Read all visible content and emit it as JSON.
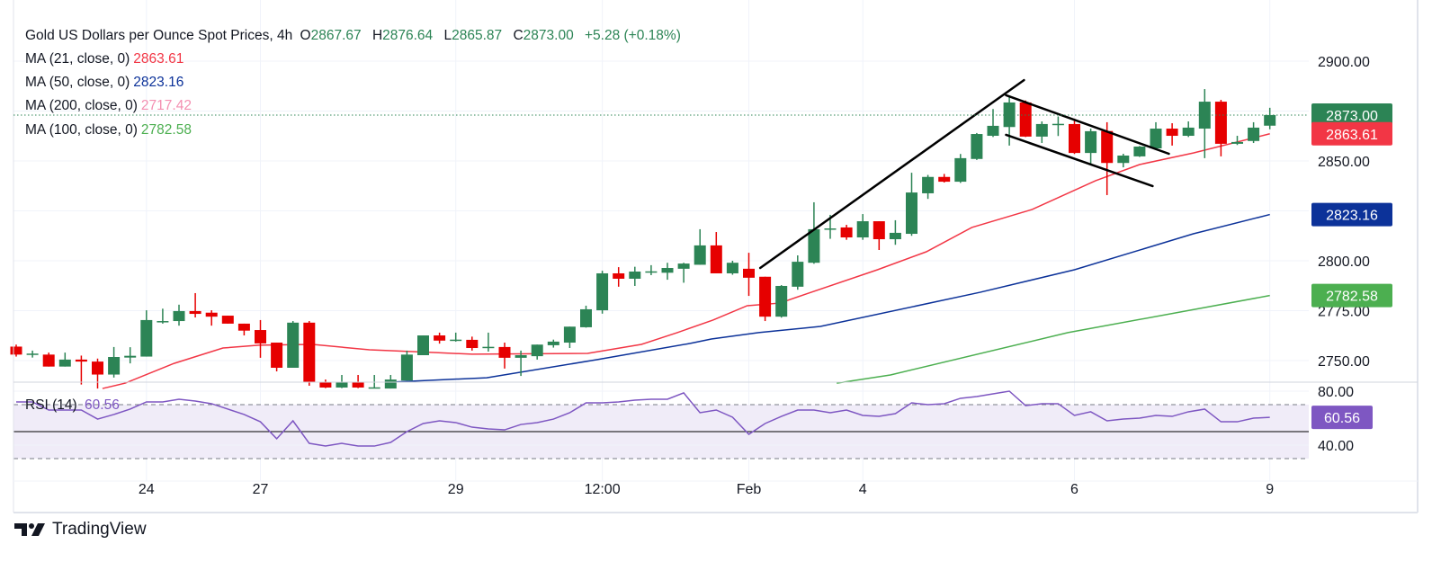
{
  "header": {
    "symbol": "Gold US Dollars per Ounce Spot Prices, 4h",
    "o_label": "O",
    "o_value": "2867.67",
    "h_label": "H",
    "h_value": "2876.64",
    "l_label": "L",
    "l_value": "2865.87",
    "c_label": "C",
    "c_value": "2873.00",
    "change": "+5.28 (+0.18%)"
  },
  "indicators": [
    {
      "label": "MA (21, close, 0)",
      "value": "2863.61",
      "color": "#f23645"
    },
    {
      "label": "MA (50, close, 0)",
      "value": "2823.16",
      "color": "#0c3299"
    },
    {
      "label": "MA (200, close, 0)",
      "value": "2717.42",
      "color": "#f48fb1"
    },
    {
      "label": "MA (100, close, 0)",
      "value": "2782.58",
      "color": "#4caf50"
    }
  ],
  "rsi": {
    "label": "RSI (14)",
    "value": "60.56",
    "color": "#7e57c2"
  },
  "branding": {
    "name": "TradingView"
  },
  "colors": {
    "up": "#2c8455",
    "down": "#e60000",
    "rsi_band": "#f0ecf8"
  },
  "chart_data": {
    "type": "candlestick",
    "timeframe": "4h",
    "price_axis": {
      "ylim": [
        2733,
        2915
      ],
      "ticks": [
        "2900.00",
        "2850.00",
        "2800.00",
        "2775.00",
        "2750.00"
      ],
      "tick_values": [
        2900,
        2850,
        2800,
        2775,
        2750
      ]
    },
    "rsi_axis": {
      "ylim": [
        25,
        85
      ],
      "ticks": [
        "80.00",
        "40.00"
      ],
      "tick_values": [
        80,
        40
      ],
      "bands": [
        70,
        30
      ],
      "midline": 50
    },
    "x_ticks": [
      {
        "label": "24",
        "bar": 9
      },
      {
        "label": "27",
        "bar": 16
      },
      {
        "label": "29",
        "bar": 28
      },
      {
        "label": "12:00",
        "bar": 37
      },
      {
        "label": "Feb",
        "bar": 46
      },
      {
        "label": "4",
        "bar": 53
      },
      {
        "label": "6",
        "bar": 66
      },
      {
        "label": "9",
        "bar": 78
      }
    ],
    "grid": true,
    "last_price": 2873.0,
    "price_badges": [
      {
        "text": "2873.00",
        "value": 2873.0,
        "color": "#2c8455"
      },
      {
        "text": "2863.61",
        "value": 2863.61,
        "color": "#f23645"
      },
      {
        "text": "2823.16",
        "value": 2823.16,
        "color": "#0c3299"
      },
      {
        "text": "2782.58",
        "value": 2782.58,
        "color": "#4caf50"
      }
    ],
    "rsi_badge": {
      "text": "60.56",
      "value": 60.56
    },
    "candles": [
      [
        2757,
        2758,
        2752,
        2753
      ],
      [
        2753.5,
        2755,
        2751.5,
        2753.5
      ],
      [
        2753,
        2754,
        2747,
        2747
      ],
      [
        2747,
        2754,
        2747,
        2750.5
      ],
      [
        2750.5,
        2752.5,
        2738,
        2749.5
      ],
      [
        2749.5,
        2751,
        2736,
        2743
      ],
      [
        2743,
        2756.8,
        2741.5,
        2751.8
      ],
      [
        2751.5,
        2756.7,
        2748.6,
        2752.4
      ],
      [
        2752,
        2775.2,
        2752,
        2770.3
      ],
      [
        2769.8,
        2776,
        2768.5,
        2769.8
      ],
      [
        2769.8,
        2778,
        2767.5,
        2774.8
      ],
      [
        2774.8,
        2783.8,
        2771.6,
        2773.4
      ],
      [
        2774,
        2775.2,
        2767.5,
        2772
      ],
      [
        2772.5,
        2772.5,
        2768.5,
        2768.5
      ],
      [
        2768.5,
        2768.5,
        2762.6,
        2765
      ],
      [
        2765.3,
        2770.3,
        2751.4,
        2758.6
      ],
      [
        2759,
        2759,
        2744.6,
        2746.4
      ],
      [
        2746.4,
        2769.8,
        2746.4,
        2769
      ],
      [
        2769,
        2769.8,
        2737.4,
        2739.2
      ],
      [
        2739,
        2740.5,
        2736.2,
        2736.5
      ],
      [
        2736.5,
        2742.8,
        2736.2,
        2739
      ],
      [
        2739,
        2742.8,
        2736.2,
        2736.5
      ],
      [
        2736.5,
        2742.8,
        2736.2,
        2736.6
      ],
      [
        2736,
        2742.8,
        2736,
        2740.5
      ],
      [
        2740,
        2755,
        2740,
        2753
      ],
      [
        2752.7,
        2762.6,
        2752.7,
        2762.6
      ],
      [
        2762.6,
        2764,
        2758.5,
        2760
      ],
      [
        2760.4,
        2764,
        2759.5,
        2760.5
      ],
      [
        2760.4,
        2762,
        2755,
        2756.3
      ],
      [
        2756.8,
        2764,
        2754.5,
        2756.9
      ],
      [
        2756.8,
        2759,
        2746,
        2751.4
      ],
      [
        2751.4,
        2755,
        2742.3,
        2752.7
      ],
      [
        2752.2,
        2758,
        2750.5,
        2758
      ],
      [
        2757.7,
        2760.5,
        2756.5,
        2759.5
      ],
      [
        2759,
        2767,
        2756.3,
        2767
      ],
      [
        2766.7,
        2777.5,
        2766.5,
        2775.7
      ],
      [
        2775.2,
        2795,
        2773.5,
        2793.7
      ],
      [
        2793.7,
        2796.8,
        2787,
        2791
      ],
      [
        2791,
        2797,
        2787.4,
        2794.6
      ],
      [
        2794.6,
        2797.8,
        2792.8,
        2794.7
      ],
      [
        2794,
        2799,
        2790.5,
        2796.4
      ],
      [
        2796,
        2799,
        2789,
        2798.6
      ],
      [
        2798,
        2815.8,
        2798,
        2807.7
      ],
      [
        2807.7,
        2814.4,
        2793.7,
        2793.7
      ],
      [
        2793.7,
        2800,
        2793,
        2799
      ],
      [
        2796,
        2804,
        2782.4,
        2791.5
      ],
      [
        2792,
        2792,
        2769.8,
        2772
      ],
      [
        2772,
        2787.8,
        2771.5,
        2787.4
      ],
      [
        2787,
        2802.7,
        2785.5,
        2799.5
      ],
      [
        2799,
        2829.3,
        2798.5,
        2815.8
      ],
      [
        2816,
        2823,
        2811,
        2816.2
      ],
      [
        2816.7,
        2818,
        2810.5,
        2811.7
      ],
      [
        2811.7,
        2823.4,
        2810.5,
        2819.8
      ],
      [
        2819.8,
        2819.8,
        2805.4,
        2810.8
      ],
      [
        2810.8,
        2820.3,
        2808,
        2814
      ],
      [
        2813.5,
        2844.1,
        2812.5,
        2834.2
      ],
      [
        2833.8,
        2843,
        2831,
        2842
      ],
      [
        2842,
        2843.5,
        2839.2,
        2839.6
      ],
      [
        2839.6,
        2853.5,
        2839,
        2851.4
      ],
      [
        2851,
        2864,
        2850.5,
        2863.5
      ],
      [
        2862.6,
        2876,
        2862,
        2867.6
      ],
      [
        2867,
        2882,
        2857.7,
        2879.3
      ],
      [
        2879.3,
        2880.3,
        2862,
        2862.2
      ],
      [
        2862.2,
        2869.8,
        2859,
        2868.5
      ],
      [
        2868.5,
        2872.3,
        2862.5,
        2868.6
      ],
      [
        2868.5,
        2871.2,
        2853.5,
        2854
      ],
      [
        2854,
        2866.2,
        2848.6,
        2864.9
      ],
      [
        2865,
        2869.4,
        2832.9,
        2849
      ],
      [
        2849,
        2853.6,
        2846.8,
        2852.7
      ],
      [
        2852.3,
        2857.5,
        2852,
        2857.2
      ],
      [
        2856.3,
        2869.4,
        2856,
        2866.2
      ],
      [
        2866.2,
        2868.9,
        2857.7,
        2862.6
      ],
      [
        2862.6,
        2869.8,
        2862,
        2866.7
      ],
      [
        2866.2,
        2886,
        2851.4,
        2879.7
      ],
      [
        2879.7,
        2880.6,
        2852.3,
        2858.6
      ],
      [
        2858.6,
        2862.6,
        2858,
        2859.5
      ],
      [
        2860,
        2869.4,
        2859,
        2866.7
      ],
      [
        2867.67,
        2876.64,
        2865.87,
        2873.0
      ]
    ],
    "ma_series": [
      {
        "name": "MA (21, close, 0)",
        "color": "#f23645",
        "points": [
          [
            6.3,
            2736
          ],
          [
            7.7,
            2738.7
          ],
          [
            10.7,
            2748.6
          ],
          [
            13.7,
            2756.3
          ],
          [
            15.9,
            2757.7
          ],
          [
            19.2,
            2758.1
          ],
          [
            22.7,
            2755.4
          ],
          [
            26.8,
            2754
          ],
          [
            29,
            2753.2
          ],
          [
            36.1,
            2753.6
          ],
          [
            39.4,
            2758.1
          ],
          [
            41.6,
            2764
          ],
          [
            43.8,
            2770.3
          ],
          [
            45.9,
            2777.5
          ],
          [
            47.9,
            2778.8
          ],
          [
            49.5,
            2783.3
          ],
          [
            53.9,
            2795.5
          ],
          [
            56.9,
            2804.5
          ],
          [
            59.7,
            2816.7
          ],
          [
            63.4,
            2825.7
          ],
          [
            67.3,
            2840.1
          ],
          [
            70,
            2848.2
          ],
          [
            73.3,
            2854
          ],
          [
            78,
            2863.61
          ]
        ]
      },
      {
        "name": "MA (50, close, 0)",
        "color": "#0c3299",
        "points": [
          [
            24,
            2739.2
          ],
          [
            29.9,
            2741.4
          ],
          [
            36.7,
            2750.5
          ],
          [
            42.4,
            2758.6
          ],
          [
            43.7,
            2760.8
          ],
          [
            46.6,
            2764
          ],
          [
            50.4,
            2767.1
          ],
          [
            60.2,
            2784.2
          ],
          [
            66,
            2795.5
          ],
          [
            73.3,
            2813.5
          ],
          [
            78,
            2823.16
          ]
        ]
      },
      {
        "name": "MA (100, close, 0)",
        "color": "#4caf50",
        "points": [
          [
            51.4,
            2738.7
          ],
          [
            54.7,
            2742.8
          ],
          [
            65.6,
            2764
          ],
          [
            78,
            2782.58
          ]
        ]
      }
    ],
    "rsi_values": [
      72,
      72,
      66,
      66,
      66,
      59.3,
      62.7,
      66.7,
      72,
      72,
      74,
      72.7,
      70.7,
      66.7,
      62.7,
      57.3,
      44.7,
      58,
      41.3,
      39.3,
      41.3,
      39.3,
      39.3,
      42,
      50,
      56,
      58,
      56.7,
      53.3,
      52,
      51.3,
      55.3,
      56.7,
      59.3,
      64,
      71.3,
      71.3,
      72,
      73.3,
      74,
      74,
      78.7,
      64,
      66,
      60.7,
      48,
      56,
      61.3,
      66,
      66,
      64,
      66,
      62,
      61.3,
      63.3,
      71.3,
      70,
      70.7,
      74.7,
      76,
      78,
      80,
      69.3,
      70.7,
      70.7,
      62,
      64.7,
      58,
      59.3,
      60,
      62,
      61.3,
      64.7,
      66.7,
      57.3,
      57.3,
      60,
      60.56
    ],
    "trendlines": [
      {
        "from": [
          46.7,
          2796.4
        ],
        "to": [
          62.9,
          2890.5
        ]
      },
      {
        "from": [
          61.8,
          2882.9
        ],
        "to": [
          71.8,
          2853.6
        ]
      },
      {
        "from": [
          61.8,
          2863.1
        ],
        "to": [
          70.8,
          2837.4
        ]
      }
    ]
  }
}
